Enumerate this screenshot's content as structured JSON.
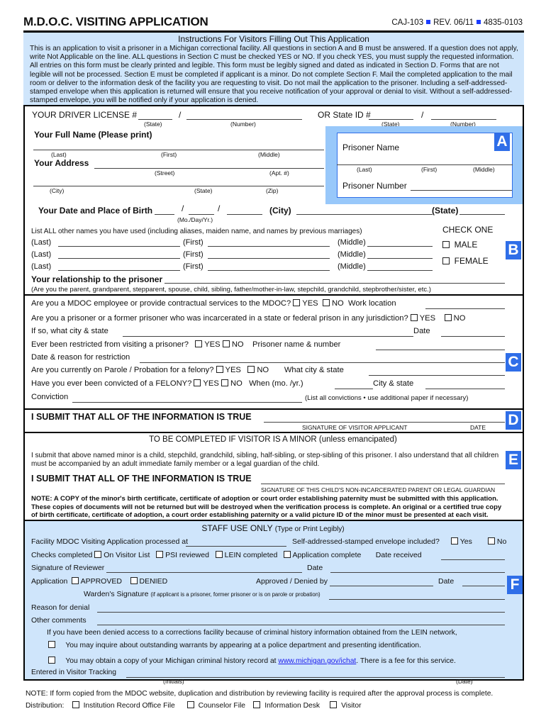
{
  "header": {
    "title": "M.D.O.C. VISITING APPLICATION",
    "form_code": "CAJ-103",
    "revision": "REV. 06/11",
    "form_number": "4835-0103"
  },
  "instructions": {
    "title": "Instructions For Visitors Filling Out This Application",
    "body": "This is an application to visit a prisoner in a Michigan correctional facility.  All questions in section A and B must be answered. If a question does not apply, write Not Applicable on the line. ALL questions in Section C must be checked YES or NO. If you check YES, you must supply the requested information.  All entries on this form must be clearly printed and legible. This form must be legibly signed and dated as indicated in Section D. Forms that are not legible will not be processed. Section E must be completed if applicant is a minor. Do not complete Section F. Mail the completed application to the mail room or deliver to the information desk of the facility you are requesting to visit.  Do not mail the application to the prisoner. Including a self-addressed-stamped envelope when this application is returned will ensure that you receive notification of your approval or denial to visit.  Without a self-addressed-stamped envelope, you will be notified only if your application is denied."
  },
  "section_b": {
    "driver_license_label": "YOUR DRIVER LICENSE #",
    "state_id_label": "OR State ID #",
    "slash": "/",
    "state_sub": "(State)",
    "number_sub": "(Number)",
    "full_name_label": "Your Full Name (Please print)",
    "last_sub": "(Last)",
    "first_sub": "(First)",
    "middle_sub": "(Middle)",
    "address_label": "Your Address",
    "street_sub": "(Street)",
    "apt_sub": "(Apt. #)",
    "city_sub": "(City)",
    "zip_sub": "(Zip)",
    "dob_label": "Your Date and Place of Birth",
    "dob_sub": "(Mo./Day/Yr.)",
    "city_label": "(City)",
    "state_label": "(State)",
    "other_names_label": "List ALL other names you have used (including aliases, maiden name, and names by previous marriages)",
    "name_row_last": "(Last)",
    "name_row_first": "(First)",
    "name_row_middle": "(Middle)",
    "check_one": "CHECK ONE",
    "male": "MALE",
    "female": "FEMALE",
    "relationship_label": "Your relationship to the prisoner",
    "relationship_hint": "(Are you the parent, grandparent, stepparent, spouse, child, sibling, father/mother-in-law, stepchild, grandchild, stepbrother/sister, etc.)",
    "badge": "B"
  },
  "section_a": {
    "badge": "A",
    "prisoner_name": "Prisoner Name",
    "last_sub": "(Last)",
    "first_sub": "(First)",
    "middle_sub": "(Middle)",
    "prisoner_number": "Prisoner Number"
  },
  "section_c": {
    "badge": "C",
    "yes": "YES",
    "no": "NO",
    "q1": "Are you a MDOC employee or provide contractual services to the MDOC?",
    "work_location": "Work location",
    "q2": "Are you a prisoner or a former prisoner who was incarcerated in a state or federal prison in any jurisdiction?",
    "city_state_if": "If so, what city & state",
    "date": "Date",
    "q3": "Ever been restricted from visiting a prisoner?",
    "prisoner_name_number": "Prisoner name & number",
    "restriction_reason": "Date & reason for restriction",
    "q4": "Are you currently on Parole / Probation for a felony?",
    "what_city_state": "What city & state",
    "q5": "Have you ever been convicted of a FELONY?",
    "when": "When (mo. /yr.)",
    "city_state": "City & state",
    "conviction": "Conviction",
    "conviction_hint": "(List all convictions • use additional paper if necessary)"
  },
  "section_d": {
    "badge": "D",
    "statement": "I SUBMIT THAT ALL OF THE INFORMATION IS TRUE",
    "signature_sub": "SIGNATURE OF VISITOR APPLICANT",
    "date_sub": "DATE"
  },
  "section_e": {
    "badge": "E",
    "title": "TO BE COMPLETED IF VISITOR IS A MINOR (unless emancipated)",
    "body": "I submit that above named minor is a child, stepchild, grandchild, sibling, half-sibling, or step-sibling of this prisoner. I also understand that all children must be accompanied by an adult immediate family member or a legal guardian of the child.",
    "statement": "I SUBMIT THAT ALL OF THE INFORMATION IS TRUE",
    "signature_sub": "SIGNATURE OF THIS CHILD'S NON-INCARCERATED PARENT OR LEGAL GUARDIAN",
    "note": "NOTE: A COPY of the minor's birth certificate, certificate of adoption or court order establishing paternity must be submitted with this application. These copies of documents will not be returned but will be destroyed when the verification process is complete.  An original or a certified true copy of birth certificate, certificate of adoption, a court order establishing paternity or a valid picture ID of the minor must be presented at each visit."
  },
  "section_f": {
    "badge": "F",
    "title": "STAFF USE ONLY",
    "title_hint": "(Type or Print Legibly)",
    "processed_at": "Facility MDOC Visiting Application processed at",
    "envelope_q": "Self-addressed-stamped envelope included?",
    "yes": "Yes",
    "no": "No",
    "checks_completed": "Checks completed",
    "on_visitor_list": "On Visitor List",
    "psi_reviewed": "PSI reviewed",
    "lein_completed": "LEIN completed",
    "application_complete": "Application complete",
    "date_received": "Date received",
    "signature_reviewer": "Signature of Reviewer",
    "date": "Date",
    "application": "Application",
    "approved": "APPROVED",
    "denied": "DENIED",
    "approved_denied_by": "Approved / Denied by",
    "wardens_signature": "Warden's Signature",
    "wardens_hint": "(if applicant is a prisoner, former prisoner or is on parole or probation)",
    "reason_denial": "Reason for denial",
    "other_comments": "Other comments",
    "lein_intro": "If you have been denied access to a corrections facility because of criminal history information obtained from the LEIN network,",
    "lein_opt1": "You may inquire about outstanding warrants by appearing at a police department and presenting identification.",
    "lein_opt2_pre": "You may obtain a copy of your Michigan criminal history record at ",
    "lein_link": "www.michigan.gov/ichat",
    "lein_opt2_post": ".  There is a fee for this service.",
    "visitor_tracking": "Entered in Visitor Tracking",
    "initials_sub": "(Initials)",
    "date_sub": "(Date)"
  },
  "footer": {
    "note": "NOTE:  If form copied from the MDOC website, duplication and distribution by reviewing facility is required after the approval process is complete.",
    "distribution": "Distribution:",
    "options": [
      "Institution Record Office File",
      "Counselor File",
      "Information Desk",
      "Visitor"
    ]
  },
  "colors": {
    "badge_blue": "#2f6ee8",
    "light_blue": "#cfe5fb",
    "panel_blue": "#98c8fa"
  }
}
